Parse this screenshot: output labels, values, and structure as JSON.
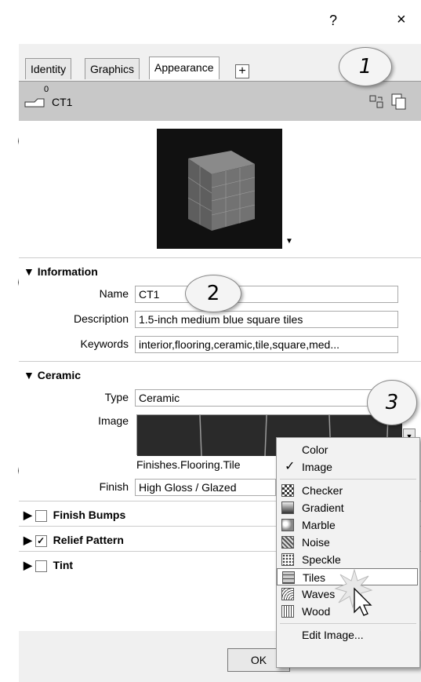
{
  "titlebar": {
    "help": "?",
    "close": "×"
  },
  "tabs": [
    {
      "label": "Identity"
    },
    {
      "label": "Graphics"
    },
    {
      "label": "Appearance"
    }
  ],
  "tab_add": "+",
  "header": {
    "count": "0",
    "name": "CT1"
  },
  "callouts": [
    "1",
    "2",
    "3"
  ],
  "information": {
    "heading": "▼ Information",
    "name_label": "Name",
    "name_value": "CT1",
    "description_label": "Description",
    "description_value": "1.5-inch medium blue square tiles",
    "keywords_label": "Keywords",
    "keywords_value": "interior,flooring,ceramic,tile,square,med..."
  },
  "ceramic": {
    "heading": "▼ Ceramic",
    "type_label": "Type",
    "type_value": "Ceramic",
    "image_label": "Image",
    "image_file": "Finishes.Flooring.Tile",
    "finish_label": "Finish",
    "finish_value": "High Gloss / Glazed"
  },
  "options": [
    {
      "label": "Finish Bumps",
      "checked": false
    },
    {
      "label": "Relief Pattern",
      "checked": true
    },
    {
      "label": "Tint",
      "checked": false
    }
  ],
  "menu": {
    "items": [
      {
        "label": "Color",
        "icon": "",
        "checked": false
      },
      {
        "label": "Image",
        "icon": "",
        "checked": true
      },
      {
        "label": "Checker",
        "icon": "checker-icon"
      },
      {
        "label": "Gradient",
        "icon": "gradient-icon"
      },
      {
        "label": "Marble",
        "icon": "marble-icon"
      },
      {
        "label": "Noise",
        "icon": "noise-icon"
      },
      {
        "label": "Speckle",
        "icon": "speckle-icon"
      },
      {
        "label": "Tiles",
        "icon": "tiles-icon",
        "highlighted": true
      },
      {
        "label": "Waves",
        "icon": "waves-icon"
      },
      {
        "label": "Wood",
        "icon": "wood-icon"
      }
    ],
    "edit_label": "Edit Image..."
  },
  "footer": {
    "ok_label": "OK"
  }
}
